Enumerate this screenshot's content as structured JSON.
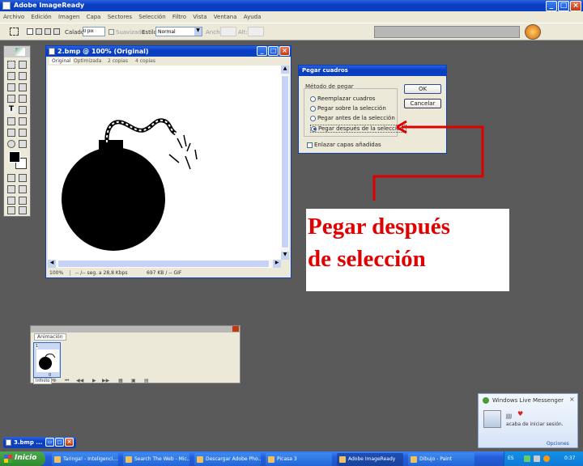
{
  "app": {
    "title": "Adobe ImageReady",
    "menu": [
      "Archivo",
      "Edición",
      "Imagen",
      "Capa",
      "Sectores",
      "Selección",
      "Filtro",
      "Vista",
      "Ventana",
      "Ayuda"
    ]
  },
  "options_bar": {
    "calado_label": "Calado:",
    "calado_value": "0 pix",
    "suavizado_label": "Suavizado",
    "estilo_label": "Estilo:",
    "estilo_value": "Normal",
    "ancho_label": "Ancho:",
    "alto_label": "Alt:"
  },
  "doc_window": {
    "title": "2.bmp @ 100% (Original)",
    "tabs": [
      "Original",
      "Optimizada",
      "2 copias",
      "4 copias"
    ],
    "zoom": "100%",
    "status_1": "-- /-- seg. a 28,8 Kbps",
    "status_2": "697 KB / -- GIF"
  },
  "dialog": {
    "title": "Pegar cuadros",
    "group_label": "Método de pegar",
    "options": [
      "Reemplazar cuadros",
      "Pegar sobre la selección",
      "Pegar antes de la selección",
      "Pegar después de la selección"
    ],
    "selected_index": 3,
    "checkbox_label": "Enlazar capas añadidas",
    "ok_label": "OK",
    "cancel_label": "Cancelar"
  },
  "annotation": {
    "line1": "Pegar después",
    "line2": "de selección",
    "color": "#e00000"
  },
  "animation_panel": {
    "tab": "Animación",
    "frame_number": "1",
    "frame_delay": "0 seg.",
    "loop_value": "Infinito"
  },
  "minimized_window": {
    "title": "3.bmp ..."
  },
  "messenger": {
    "title": "Windows Live Messenger",
    "name": "JJJJ",
    "message": "acaba de iniciar sesión.",
    "options_label": "Opciones"
  },
  "taskbar": {
    "start_label": "Inicio",
    "items": [
      "Taringa! - Inteligenci...",
      "Search The Web - Mic...",
      "Descargar Adobe Pho...",
      "Picasa 3",
      "Adobe ImageReady",
      "Dibujo - Paint"
    ],
    "active_index": 4,
    "lang": "ES",
    "clock": "0:37"
  }
}
